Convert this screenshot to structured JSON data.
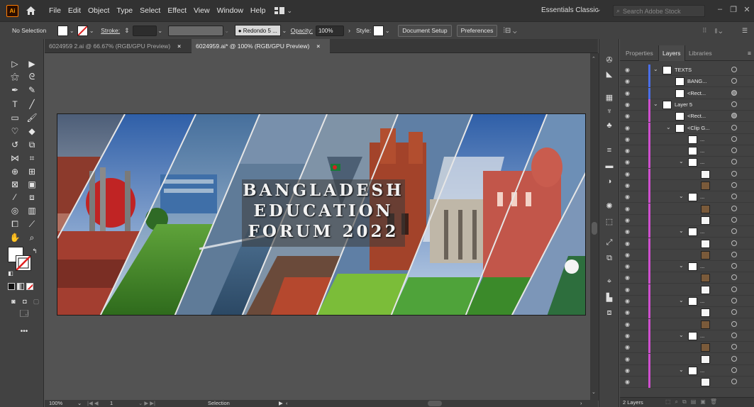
{
  "app": {
    "logo": "Ai",
    "home_icon": "home-icon"
  },
  "menus": [
    "File",
    "Edit",
    "Object",
    "Type",
    "Select",
    "Effect",
    "View",
    "Window",
    "Help"
  ],
  "workspace": "Essentials Classic",
  "search_placeholder": "Search Adobe Stock",
  "control": {
    "selection": "No Selection",
    "stroke_label": "Stroke:",
    "brush": "Redondo 5 ...",
    "opacity_label": "Opacity:",
    "opacity_value": "100%",
    "style_label": "Style:",
    "doc_setup": "Document Setup",
    "preferences": "Preferences"
  },
  "tabs": [
    {
      "label": "6024959 2.ai @ 66.67% (RGB/GPU Preview)"
    },
    {
      "label": "6024959.ai* @ 100% (RGB/GPU Preview)"
    }
  ],
  "tab_close": "×",
  "artwork": {
    "line1": "BANGLADESH",
    "line2": "EDUCATION",
    "line3": "FORUM 2022"
  },
  "status": {
    "zoom": "100%",
    "artboard": "1",
    "tool": "Selection"
  },
  "panel": {
    "tabs": [
      "Properties",
      "Layers",
      "Libraries"
    ],
    "footer": "2 Layers"
  },
  "layers": [
    {
      "name": "TEXTS",
      "level": 0,
      "chev": true,
      "color": "#4a6fe8"
    },
    {
      "name": "BANG...",
      "level": 1,
      "color": "#4a6fe8"
    },
    {
      "name": "<Rect...",
      "level": 1,
      "color": "#4a6fe8"
    },
    {
      "name": "Layer 5",
      "level": 0,
      "chev": true,
      "color": "#d04fd0"
    },
    {
      "name": "<Rect...",
      "level": 1,
      "color": "#d04fd0"
    },
    {
      "name": "<Clip G...",
      "level": 1,
      "chev": true,
      "color": "#d04fd0"
    },
    {
      "name": "...",
      "level": 2,
      "color": "#d04fd0"
    },
    {
      "name": "...",
      "level": 2,
      "color": "#d04fd0"
    },
    {
      "name": "...",
      "level": 2,
      "chev": true,
      "color": "#d04fd0"
    },
    {
      "name": "",
      "level": 3,
      "color": "#d04fd0"
    },
    {
      "name": "",
      "level": 3,
      "color": "#d04fd0"
    },
    {
      "name": "...",
      "level": 2,
      "chev": true,
      "color": "#d04fd0"
    },
    {
      "name": "",
      "level": 3,
      "color": "#d04fd0"
    },
    {
      "name": "",
      "level": 3,
      "color": "#d04fd0"
    },
    {
      "name": "...",
      "level": 2,
      "chev": true,
      "color": "#d04fd0"
    },
    {
      "name": "",
      "level": 3,
      "color": "#d04fd0"
    },
    {
      "name": "",
      "level": 3,
      "color": "#d04fd0"
    },
    {
      "name": "...",
      "level": 2,
      "chev": true,
      "color": "#d04fd0"
    },
    {
      "name": "",
      "level": 3,
      "color": "#d04fd0"
    },
    {
      "name": "",
      "level": 3,
      "color": "#d04fd0"
    },
    {
      "name": "...",
      "level": 2,
      "chev": true,
      "color": "#d04fd0"
    },
    {
      "name": "",
      "level": 3,
      "color": "#d04fd0"
    },
    {
      "name": "",
      "level": 3,
      "color": "#d04fd0"
    },
    {
      "name": "...",
      "level": 2,
      "chev": true,
      "color": "#d04fd0"
    },
    {
      "name": "",
      "level": 3,
      "color": "#d04fd0"
    },
    {
      "name": "",
      "level": 3,
      "color": "#d04fd0"
    },
    {
      "name": "...",
      "level": 2,
      "chev": true,
      "color": "#d04fd0"
    },
    {
      "name": "",
      "level": 3,
      "color": "#d04fd0"
    }
  ]
}
